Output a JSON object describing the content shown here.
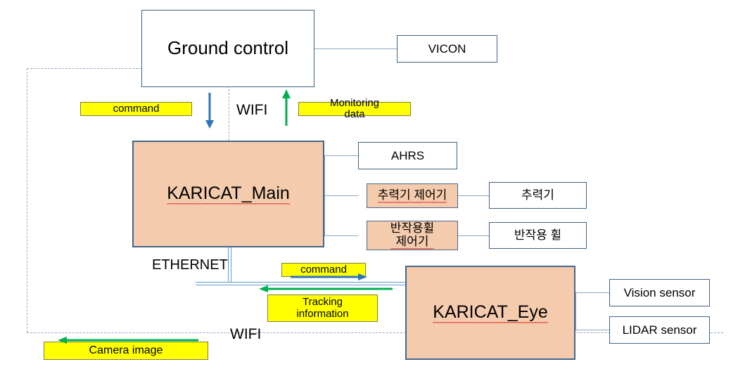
{
  "diagram": {
    "title": "KARICAT system architecture block diagram",
    "colors": {
      "node_fill_peach": "#f5cbad",
      "node_fill_white": "#ffffff",
      "node_border": "#44678b",
      "label_fill": "#ffff00",
      "connector": "#8ba6c0",
      "bus": "#5b9bd5",
      "arrow_down": "#2e75b6",
      "arrow_up": "#00b050",
      "dashed_wifi": "#8fa8c8"
    }
  },
  "nodes": {
    "ground_control": "Ground control",
    "vicon": "VICON",
    "karicat_main": "KARICAT_Main",
    "ahrs": "AHRS",
    "thruster_controller": "추력기 제어기",
    "thruster": "추력기",
    "reaction_wheel_controller": "반작용휠\n제어기",
    "reaction_wheel": "반작용 휠",
    "karicat_eye": "KARICAT_Eye",
    "vision_sensor": "Vision sensor",
    "lidar_sensor": "LIDAR sensor"
  },
  "labels": {
    "command_top": "command",
    "monitoring_data": "Monitoring\ndata",
    "command_bus": "command",
    "tracking_information": "Tracking\ninformation",
    "camera_image": "Camera image"
  },
  "link_texts": {
    "wifi_top": "WIFI",
    "wifi_bottom": "WIFI",
    "ethernet": "ETHERNET"
  },
  "arrows": [
    {
      "name": "command-down-arrow",
      "direction": "down",
      "color": "#2e75b6"
    },
    {
      "name": "monitoring-up-arrow",
      "direction": "up",
      "color": "#00b050"
    },
    {
      "name": "command-right-arrow",
      "direction": "right",
      "color": "#2e75b6"
    },
    {
      "name": "tracking-left-arrow",
      "direction": "left",
      "color": "#00b050"
    },
    {
      "name": "camera-image-left-arrow",
      "direction": "left",
      "color": "#00b050"
    }
  ]
}
